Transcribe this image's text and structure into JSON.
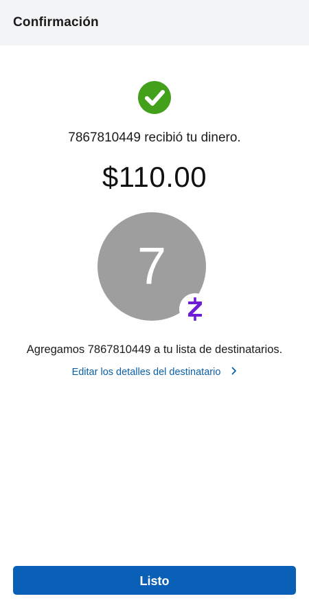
{
  "header": {
    "title": "Confirmación"
  },
  "confirmation": {
    "status_icon": "check-circle-icon",
    "received_message": "7867810449 recibió tu dinero.",
    "amount": "$110.00"
  },
  "recipient": {
    "avatar_initial": "7",
    "avatar_color": "#9e9e9e",
    "badge_icon": "zelle-icon",
    "added_message": "Agregamos 7867810449 a tu lista de destinatarios.",
    "edit_link_label": "Editar los detalles del destinatario"
  },
  "actions": {
    "done_label": "Listo"
  },
  "colors": {
    "success": "#43a01b",
    "primary": "#0a60b6",
    "link": "#0b5ea8",
    "zelle": "#6d1ed4"
  }
}
